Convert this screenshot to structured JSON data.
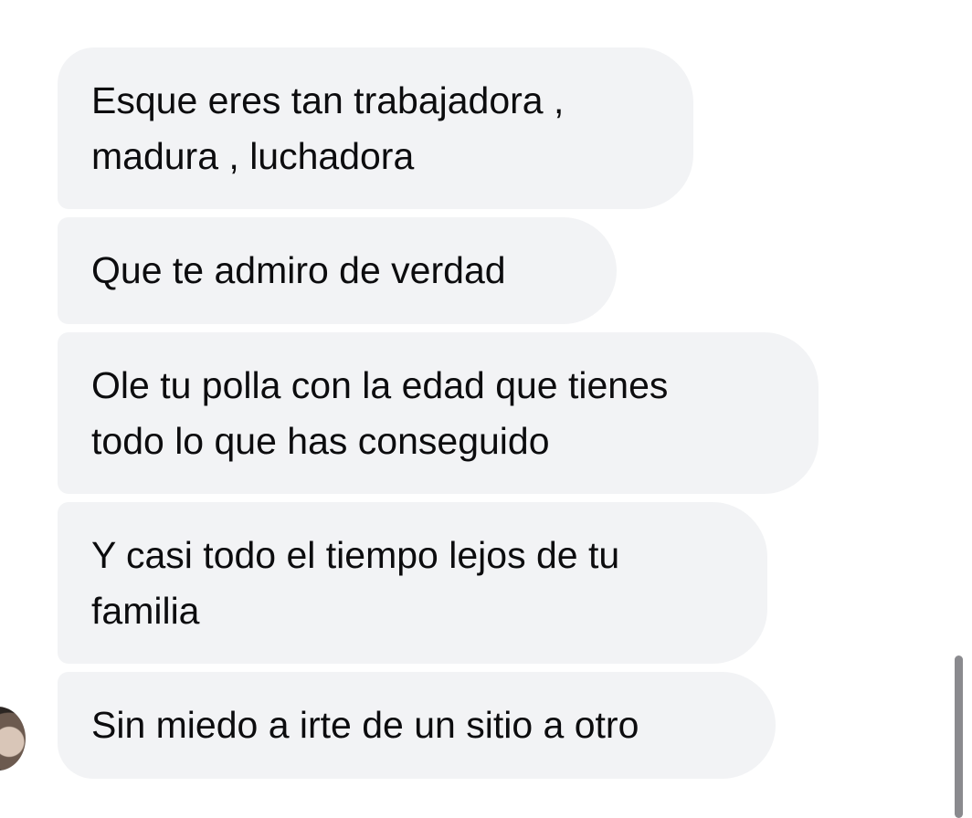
{
  "messages": [
    {
      "text": "Esque eres tan trabajadora ,\nmadura , luchadora"
    },
    {
      "text": "Que te admiro de verdad"
    },
    {
      "text": "Ole tu polla con la edad que tienes\ntodo lo que has conseguido"
    },
    {
      "text": "Y casi todo el tiempo lejos de tu\nfamilia"
    },
    {
      "text": "Sin miedo a irte de un sitio a otro"
    }
  ],
  "colors": {
    "bubble_background": "#f2f3f5",
    "text": "#0c0c0e",
    "page_background": "#ffffff"
  }
}
